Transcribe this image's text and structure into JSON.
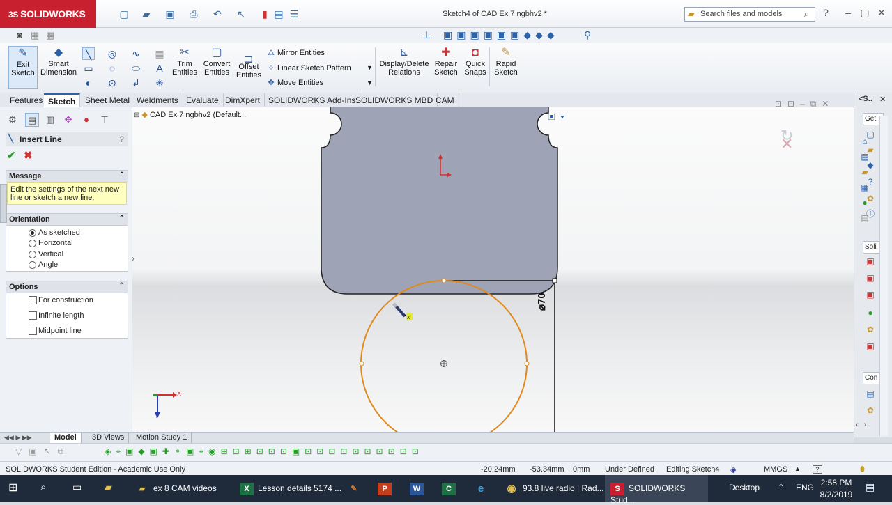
{
  "app": {
    "brand": "SOLIDWORKS",
    "brand_prefix": "3S",
    "doc_title": "Sketch4 of CAD Ex 7 ngbhv2 *"
  },
  "search": {
    "placeholder": "Search files and models"
  },
  "command_manager": {
    "exit_sketch": [
      "Exit",
      "Sketch"
    ],
    "smart_dimension": [
      "Smart",
      "Dimension"
    ],
    "trim_entities": [
      "Trim",
      "Entities"
    ],
    "convert_entities": [
      "Convert",
      "Entities"
    ],
    "offset_entities": [
      "Offset",
      "Entities"
    ],
    "mirror_entities": "Mirror Entities",
    "linear_sketch_pattern": "Linear Sketch Pattern",
    "move_entities": "Move Entities",
    "display_delete_relations": [
      "Display/Delete",
      "Relations"
    ],
    "repair_sketch": [
      "Repair",
      "Sketch"
    ],
    "quick_snaps": [
      "Quick",
      "Snaps"
    ],
    "rapid_sketch": [
      "Rapid",
      "Sketch"
    ]
  },
  "tabs": [
    "Features",
    "Sketch",
    "Sheet Metal",
    "Weldments",
    "Evaluate",
    "DimXpert",
    "SOLIDWORKS Add-Ins",
    "SOLIDWORKS MBD",
    "CAM"
  ],
  "active_tab": "Sketch",
  "property_manager": {
    "title": "Insert Line",
    "help": "?",
    "message_header": "Message",
    "message_text_1": "Edit the settings of the next new",
    "message_text_2": "line or sketch a new line.",
    "orientation_header": "Orientation",
    "orientation_options": [
      "As sketched",
      "Horizontal",
      "Vertical",
      "Angle"
    ],
    "orientation_selected": "As sketched",
    "options_header": "Options",
    "options": [
      "For construction",
      "Infinite length",
      "Midpoint line"
    ]
  },
  "feature_tree": {
    "root": "CAD Ex 7 ngbhv2  (Default..."
  },
  "graphics": {
    "dimension_label": "⌀70",
    "triad_x": "X",
    "triad_y": "Y"
  },
  "right_pane": {
    "labels": [
      "Get",
      "Soli",
      "Con"
    ]
  },
  "bottom_tabs": [
    "Model",
    "3D Views",
    "Motion Study 1"
  ],
  "active_bottom_tab": "Model",
  "status": {
    "edition": "SOLIDWORKS Student Edition - Academic Use Only",
    "x": "-20.24mm",
    "y": "-53.34mm",
    "z": "0mm",
    "state": "Under Defined",
    "editing": "Editing Sketch4",
    "units": "MMGS"
  },
  "taskbar": {
    "items": [
      "ex 8 CAM videos",
      "Lesson details 5174 ...",
      "93.8 live radio | Rad...",
      "SOLIDWORKS Stud..."
    ],
    "desktop": "Desktop",
    "lang": "ENG",
    "time": "2:58 PM",
    "date": "8/2/2019"
  },
  "colors": {
    "brand_red": "#c8202e",
    "sketch_orange": "#e08a1e",
    "part_fill": "#9ea3b6",
    "accent": "#2d62a8"
  }
}
